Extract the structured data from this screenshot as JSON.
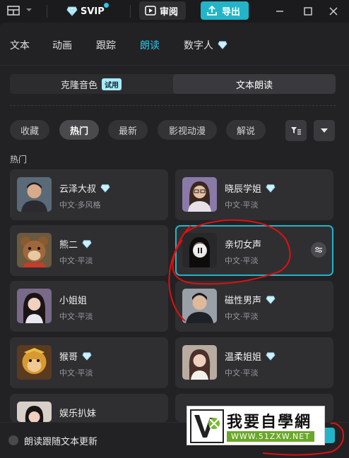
{
  "titlebar": {
    "svip_label": "SVIP",
    "review_label": "审阅",
    "export_label": "导出"
  },
  "tabs": [
    {
      "label": "文本",
      "active": false
    },
    {
      "label": "动画",
      "active": false
    },
    {
      "label": "跟踪",
      "active": false
    },
    {
      "label": "朗读",
      "active": true
    },
    {
      "label": "数字人",
      "active": false
    }
  ],
  "segmented": {
    "clone_label": "克隆音色",
    "trial_badge": "试用",
    "read_label": "文本朗读"
  },
  "filters": [
    {
      "label": "收藏",
      "active": false
    },
    {
      "label": "热门",
      "active": true
    },
    {
      "label": "最新",
      "active": false
    },
    {
      "label": "影视动漫",
      "active": false
    },
    {
      "label": "解说",
      "active": false
    }
  ],
  "section_label": "热门",
  "voices": [
    {
      "name": "云泽大叔",
      "desc": "中文·多风格",
      "vip": true
    },
    {
      "name": "晓辰学姐",
      "desc": "中文·平淡",
      "vip": true
    },
    {
      "name": "熊二",
      "desc": "中文·平淡",
      "vip": true
    },
    {
      "name": "亲切女声",
      "desc": "中文·平淡",
      "vip": false,
      "selected": true
    },
    {
      "name": "小姐姐",
      "desc": "中文·平淡",
      "vip": false
    },
    {
      "name": "磁性男声",
      "desc": "中文·平淡",
      "vip": true
    },
    {
      "name": "猴哥",
      "desc": "中文·平淡",
      "vip": true
    },
    {
      "name": "温柔姐姐",
      "desc": "中文·平淡",
      "vip": true
    },
    {
      "name": "娱乐扒妹",
      "desc": "",
      "vip": false
    }
  ],
  "bottom": {
    "follow_label": "朗读跟随文本更新"
  },
  "watermark": {
    "title": "我要自學網",
    "url": "WWW.51ZXW.NET"
  },
  "colors": {
    "accent": "#22b4c8",
    "active_tab": "#2ec6e6",
    "annotation": "#e01010"
  },
  "icons": {
    "diamond": "diamond-icon",
    "pause": "pause-icon",
    "settings": "sliders-icon"
  }
}
